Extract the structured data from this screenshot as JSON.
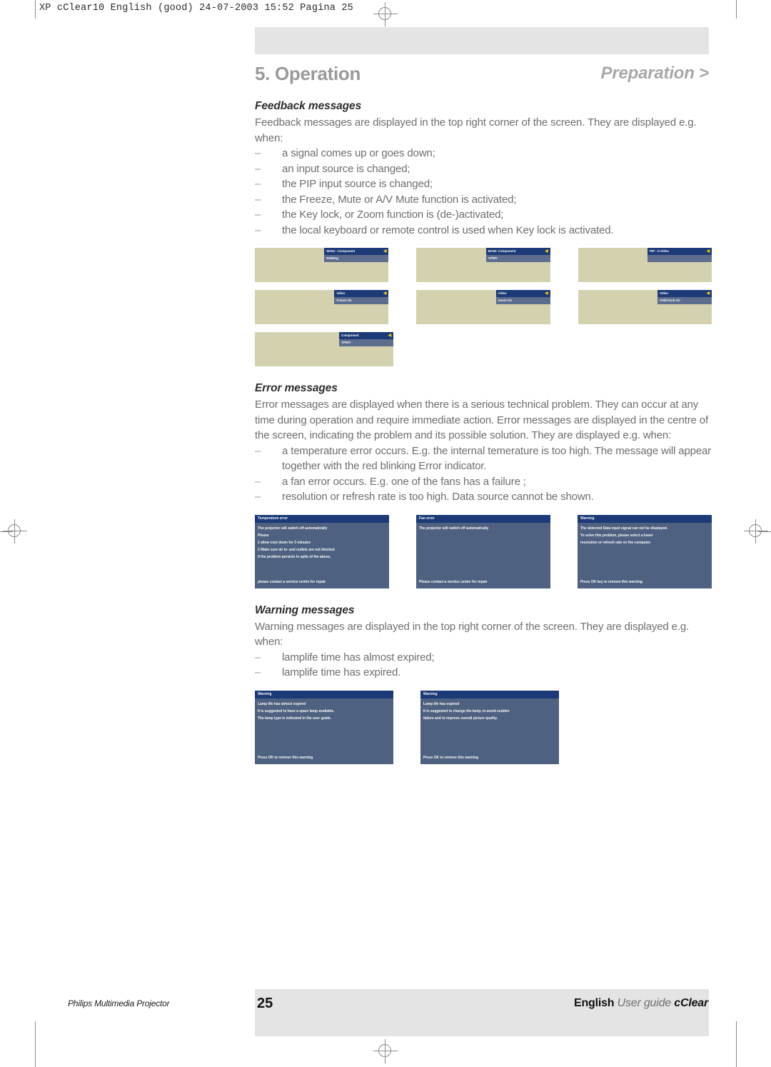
{
  "slug": "XP cClear10 English (good)  24-07-2003  15:52  Pagina 25",
  "chapter": {
    "title": "5. Operation",
    "breadcrumb": "Preparation >"
  },
  "sections": {
    "feedback": {
      "heading": "Feedback messages",
      "intro": "Feedback messages are displayed in the top right corner of the screen. They are displayed e.g. when:",
      "bullets": [
        "a signal comes up or goes down;",
        "an input source is changed;",
        "the PIP input source is changed;",
        "the Freeze, Mute or A/V Mute function is activated;",
        "the Key lock, or Zoom function is (de-)activated;",
        "the local keyboard or remote control is used when Key lock is activated."
      ],
      "screens": [
        [
          {
            "title": "MAIN : Component",
            "body": "RGBing",
            "speaker": "◀",
            "wide": true
          },
          {
            "title": "MAIN: Component",
            "body": "YPbPr",
            "speaker": "◀",
            "wide": true
          },
          {
            "title": "PIP : S-Video",
            "body": "",
            "speaker": "◀",
            "wide": true
          }
        ],
        [
          {
            "title": "Video",
            "body": "Freeze On",
            "speaker": "◀",
            "wide": false
          },
          {
            "title": "Video",
            "body": "Zoom On",
            "speaker": "◀",
            "wide": false
          },
          {
            "title": "Video",
            "body": "Child-lock On",
            "speaker": "◀",
            "wide": false
          }
        ],
        [
          {
            "title": "Component",
            "body": "YPbPr",
            "speaker": "◀",
            "wide": false
          }
        ]
      ]
    },
    "error": {
      "heading": "Error messages",
      "intro": "Error messages are displayed when there is a serious technical problem. They can occur at any time during operation and require immediate action. Error messages are displayed in the centre of the screen, indicating the problem and its possible solution. They are displayed e.g. when:",
      "bullets": [
        "a temperature error occurs. E.g. the internal temerature is too high. The message will appear together with the red blinking Error indicator.",
        "a fan error occurs. E.g. one of the fans has a failure ;",
        "resolution or refresh rate is too high. Data source cannot be shown."
      ],
      "boxes": [
        {
          "title": "Temperature error",
          "lines": [
            "The projector will switch off automatically",
            "Please",
            "1 allow cool down for 3 minutes",
            "2 Make sure air in- and outlets are not blocked",
            "if the problem persists in spite of the above,"
          ],
          "footer": "please contact a service centre for repair"
        },
        {
          "title": "Fan error",
          "lines": [
            "The projector will switch off automatically"
          ],
          "footer": "Please contact a service centre for repair"
        },
        {
          "title": "Warning",
          "lines": [
            "The detected Data input signal can not be displayed.",
            "To solve this problem, please select a lower",
            "resolution or refresh rate on the computer."
          ],
          "footer": "Press OK key to remove this warning."
        }
      ]
    },
    "warning": {
      "heading": "Warning messages",
      "intro": "Warning messages are displayed in the top right corner of the screen. They are displayed e.g. when:",
      "bullets": [
        "lamplife time has almost expired;",
        "lamplife time has expired."
      ],
      "boxes": [
        {
          "title": "Warning",
          "lines": [
            "Lamp life has almost expired",
            "It is suggested to have a spare lamp available.",
            "The lamp type is indicated in the user guide."
          ],
          "footer": "Press OK to remove this warning"
        },
        {
          "title": "Warning",
          "lines": [
            "Lamp life has expired",
            "It is suggested to change the lamp, to avoid sudden",
            "failure and to improve overall picture quality."
          ],
          "footer": "Press OK to remove this warning"
        }
      ]
    }
  },
  "footer": {
    "left": "Philips Multimedia Projector",
    "page_number": "25",
    "right_language": "English",
    "right_guide": "User guide",
    "right_product": "cClear"
  }
}
